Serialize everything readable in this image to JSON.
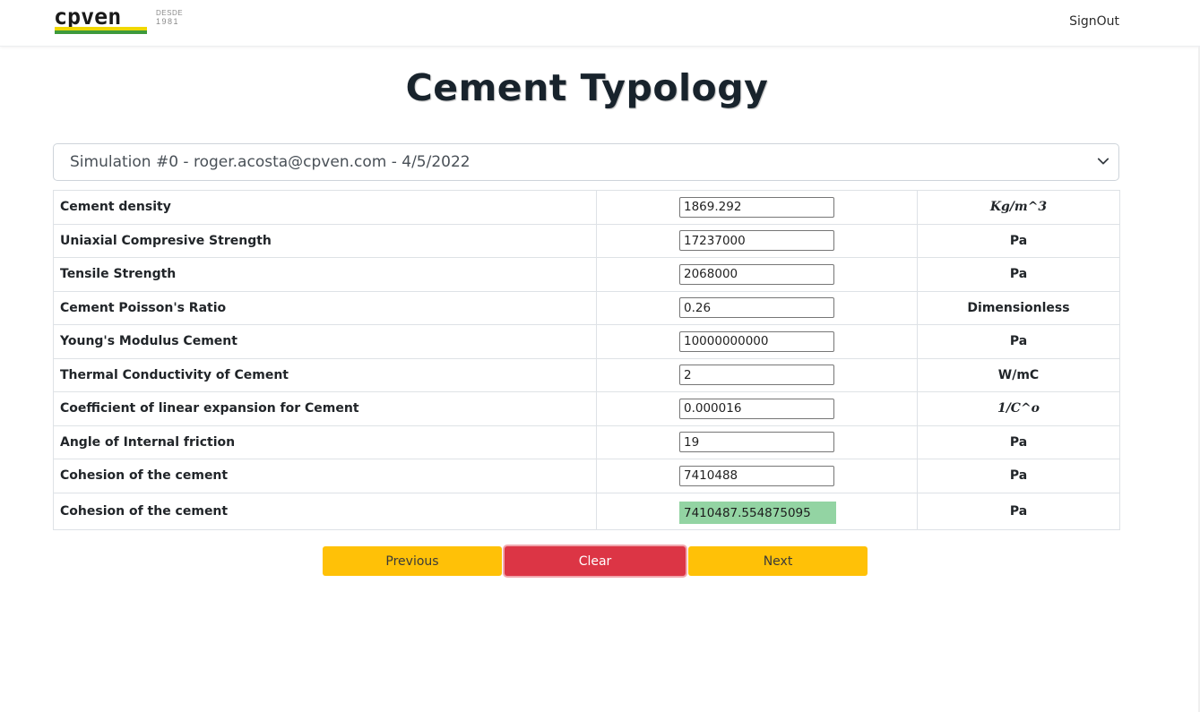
{
  "header": {
    "logo_text": "cpven",
    "logo_desde": "DESDE",
    "logo_year": "1981",
    "signout_label": "SignOut"
  },
  "page": {
    "title": "Cement Typology"
  },
  "simulation_select": {
    "selected": "Simulation #0 - roger.acosta@cpven.com - 4/5/2022"
  },
  "parameters": [
    {
      "label": "Cement density",
      "value": "1869.292",
      "unit": "Kg/m^3"
    },
    {
      "label": "Uniaxial Compresive Strength",
      "value": "17237000",
      "unit": "Pa"
    },
    {
      "label": "Tensile Strength",
      "value": "2068000",
      "unit": "Pa"
    },
    {
      "label": "Cement Poisson's Ratio",
      "value": "0.26",
      "unit": "Dimensionless"
    },
    {
      "label": "Young's Modulus Cement",
      "value": "10000000000",
      "unit": "Pa"
    },
    {
      "label": "Thermal Conductivity of Cement",
      "value": "2",
      "unit": "W/mC"
    },
    {
      "label": "Coefficient of linear expansion for Cement",
      "value": "0.000016",
      "unit": "1/C^o"
    },
    {
      "label": "Angle of Internal friction",
      "value": "19",
      "unit": "Pa"
    },
    {
      "label": "Cohesion of the cement",
      "value": "7410488",
      "unit": "Pa"
    }
  ],
  "result_row": {
    "label": "Cohesion of the cement",
    "value": "7410487.554875095",
    "unit": "Pa",
    "highlight_color": "#93d4a3"
  },
  "buttons": {
    "previous_label": "Previous",
    "clear_label": "Clear",
    "next_label": "Next",
    "primary_color": "#ffc107",
    "danger_color": "#dc3545"
  },
  "icons": {
    "select_chevron": "chevron-down-icon"
  }
}
